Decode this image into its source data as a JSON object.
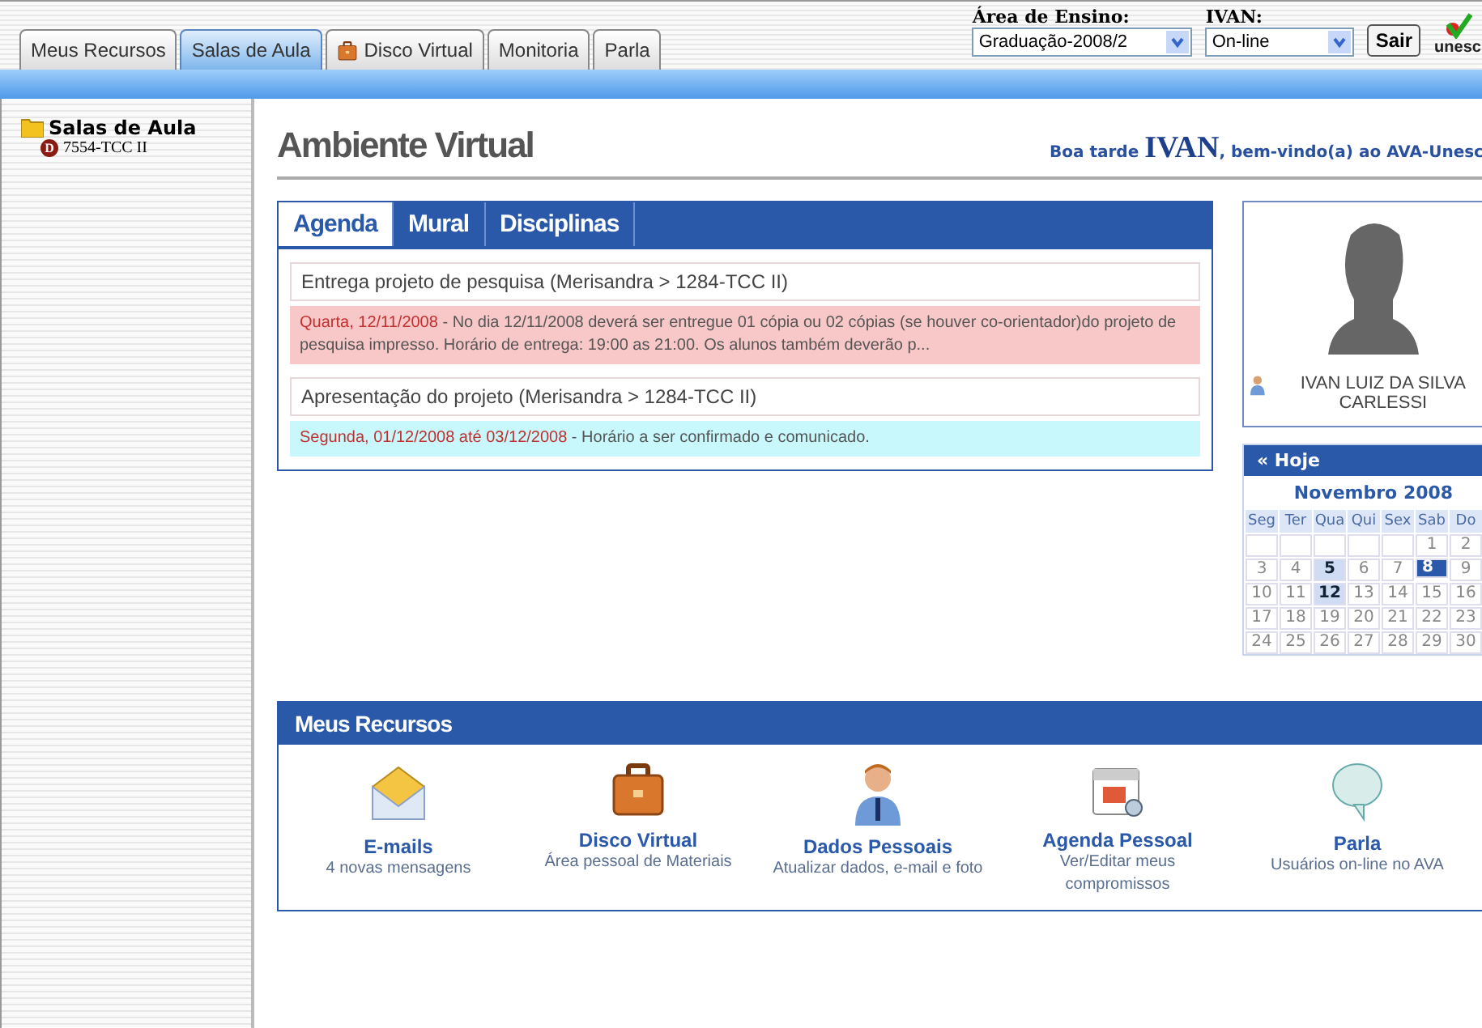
{
  "top_tabs": [
    {
      "label": "Meus Recursos",
      "selected": false,
      "icon": false
    },
    {
      "label": "Salas de Aula",
      "selected": true,
      "icon": false
    },
    {
      "label": "Disco Virtual",
      "selected": false,
      "icon": true
    },
    {
      "label": "Monitoria",
      "selected": false,
      "icon": false
    },
    {
      "label": "Parla",
      "selected": false,
      "icon": false
    }
  ],
  "area_select": {
    "label": "Área de Ensino:",
    "value": "Graduação-2008/2"
  },
  "status_select": {
    "label": "IVAN:",
    "value": "On-line"
  },
  "exit_button": "Sair",
  "logo_text": "unesc",
  "sidebar": {
    "items": [
      {
        "label": "Salas de Aula",
        "children": [
          {
            "label": "7554-TCC II",
            "badge": "D"
          }
        ]
      }
    ]
  },
  "page_title": "Ambiente Virtual",
  "greeting": "Boa tarde **IVAN**, bem-vindo(a) ao AVA-Unesc",
  "panel_tabs": [
    {
      "label": "Agenda",
      "selected": true
    },
    {
      "label": "Mural",
      "selected": false
    },
    {
      "label": "Disciplinas",
      "selected": false
    }
  ],
  "agenda": [
    {
      "title": "Entrega projeto de pesquisa (Merisandra > 1284-TCC II)",
      "date": "Quarta, 12/11/2008",
      "text": " - No dia 12/11/2008 deverá ser entregue 01 cópia ou 02 cópias (se houver co-orientador)do projeto de pesquisa impresso. Horário de entrega: 19:00 as 21:00. Os alunos também deverão p...",
      "color": "#f8c8c8"
    },
    {
      "title": "Apresentação do projeto (Merisandra > 1284-TCC II)",
      "date": "Segunda, 01/12/2008 até 03/12/2008",
      "text": " - Horário a ser confirmado e comunicado.",
      "color": "#c8f8fc"
    }
  ],
  "profile": {
    "name": "IVAN LUIZ DA SILVA CARLESSI"
  },
  "calendar": {
    "today_label": "« Hoje",
    "month": "Novembro 2008",
    "weekdays": [
      "Seg",
      "Ter",
      "Qua",
      "Qui",
      "Sex",
      "Sab",
      "Do"
    ],
    "weeks": [
      [
        {
          "kind": "blank"
        },
        {
          "kind": "blank"
        },
        {
          "kind": "blank"
        },
        {
          "kind": "blank"
        },
        {
          "kind": "blank"
        },
        {
          "kind": "day",
          "day": "1",
          "selected": false,
          "event": false
        },
        {
          "kind": "day",
          "day": "2",
          "selected": false,
          "event": false
        }
      ],
      [
        {
          "kind": "day",
          "day": "3",
          "selected": false,
          "event": false
        },
        {
          "kind": "day",
          "day": "4",
          "selected": false,
          "event": false
        },
        {
          "kind": "day",
          "day": "5",
          "selected": false,
          "event": true
        },
        {
          "kind": "day",
          "day": "6",
          "selected": false,
          "event": false
        },
        {
          "kind": "day",
          "day": "7",
          "selected": false,
          "event": false
        },
        {
          "kind": "day",
          "day": "8",
          "selected": true,
          "event": false
        },
        {
          "kind": "day",
          "day": "9",
          "selected": false,
          "event": false
        }
      ],
      [
        {
          "kind": "day",
          "day": "10",
          "selected": false,
          "event": false
        },
        {
          "kind": "day",
          "day": "11",
          "selected": false,
          "event": false
        },
        {
          "kind": "day",
          "day": "12",
          "selected": false,
          "event": true
        },
        {
          "kind": "day",
          "day": "13",
          "selected": false,
          "event": false
        },
        {
          "kind": "day",
          "day": "14",
          "selected": false,
          "event": false
        },
        {
          "kind": "day",
          "day": "15",
          "selected": false,
          "event": false
        },
        {
          "kind": "day",
          "day": "16",
          "selected": false,
          "event": false
        }
      ],
      [
        {
          "kind": "day",
          "day": "17",
          "selected": false,
          "event": false
        },
        {
          "kind": "day",
          "day": "18",
          "selected": false,
          "event": false
        },
        {
          "kind": "day",
          "day": "19",
          "selected": false,
          "event": false
        },
        {
          "kind": "day",
          "day": "20",
          "selected": false,
          "event": false
        },
        {
          "kind": "day",
          "day": "21",
          "selected": false,
          "event": false
        },
        {
          "kind": "day",
          "day": "22",
          "selected": false,
          "event": false
        },
        {
          "kind": "day",
          "day": "23",
          "selected": false,
          "event": false
        }
      ],
      [
        {
          "kind": "day",
          "day": "24",
          "selected": false,
          "event": false
        },
        {
          "kind": "day",
          "day": "25",
          "selected": false,
          "event": false
        },
        {
          "kind": "day",
          "day": "26",
          "selected": false,
          "event": false
        },
        {
          "kind": "day",
          "day": "27",
          "selected": false,
          "event": false
        },
        {
          "kind": "day",
          "day": "28",
          "selected": false,
          "event": false
        },
        {
          "kind": "day",
          "day": "29",
          "selected": false,
          "event": false
        },
        {
          "kind": "day",
          "day": "30",
          "selected": false,
          "event": false
        }
      ]
    ]
  },
  "resources": {
    "title": "Meus Recursos",
    "items": [
      {
        "kind": "mail",
        "title": "E-mails",
        "subtitle": "4 novas mensagens"
      },
      {
        "kind": "briefcase",
        "title": "Disco Virtual",
        "subtitle": "Área pessoal de Materiais"
      },
      {
        "kind": "person",
        "title": "Dados Pessoais",
        "subtitle": "Atualizar dados, e-mail e foto"
      },
      {
        "kind": "calendar",
        "title": "Agenda Pessoal",
        "subtitle": "Ver/Editar meus compromissos"
      },
      {
        "kind": "chat",
        "title": "Parla",
        "subtitle": "Usuários on-line no AVA"
      }
    ]
  }
}
